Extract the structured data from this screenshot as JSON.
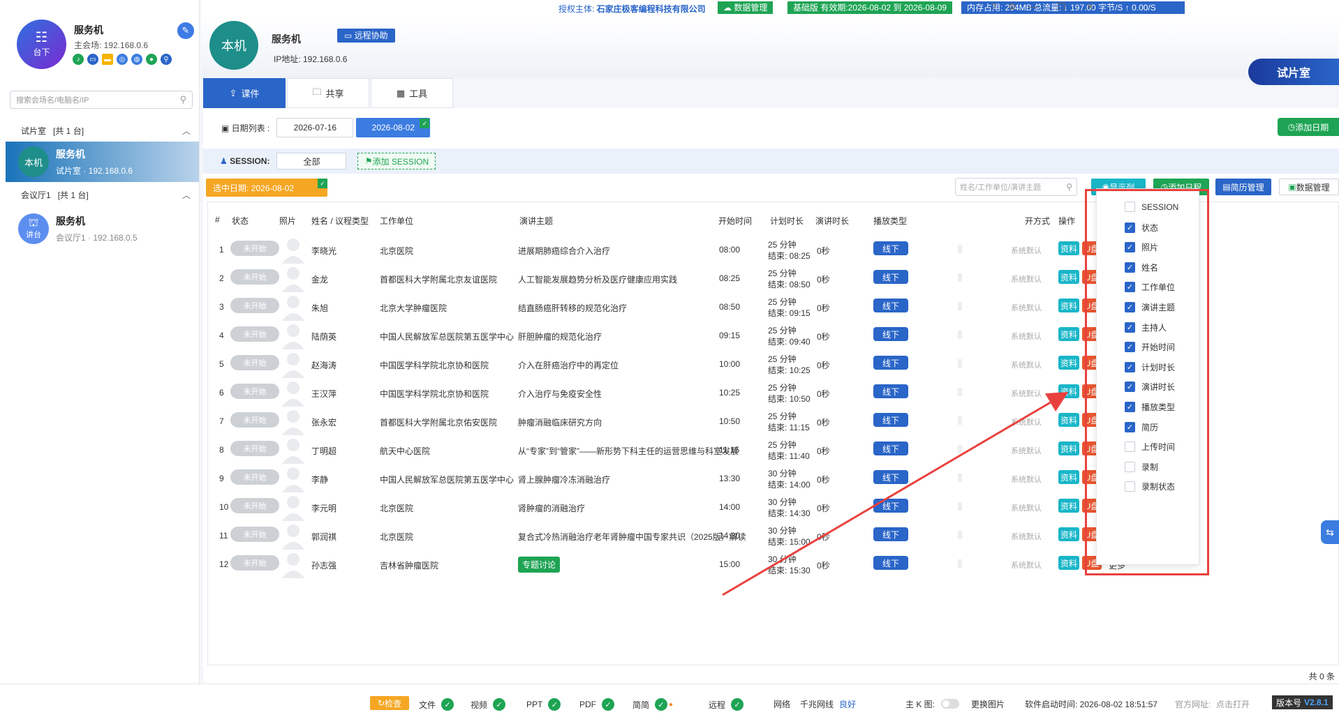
{
  "left": {
    "host": {
      "avatar_line1": "台下",
      "name": "服务机",
      "ip": "主会场: 192.168.0.6"
    },
    "search_placeholder": "搜索会场名/电脑名/IP",
    "groups": [
      {
        "name": "试片室",
        "count": "[共 1 台]"
      },
      {
        "name": "会议厅1",
        "count": "[共 1 台]"
      }
    ],
    "devices": [
      {
        "avatar": "本机",
        "name": "服务机",
        "sub": "试片室 · 192.168.0.6"
      },
      {
        "avatar": "讲台",
        "name": "服务机",
        "sub": "会议厅1 · 192.168.0.5"
      }
    ]
  },
  "topbar": {
    "auth_prefix": "授权主体: ",
    "auth_company": "石家庄极客编程科技有限公司",
    "data_mgmt": "数据管理",
    "license": "基础版 有效期:2026-08-02 到 2026-08-09",
    "memory": "内存占用:  204MB   总流量:  ↓ 197.00 字节/S    ↑ 0.00/S"
  },
  "header": {
    "avatar": "本机",
    "name": "服务机",
    "remote_btn": "远程协助",
    "ip": "IP地址: 192.168.0.6",
    "room": "试片室"
  },
  "tabs": [
    {
      "label": "课件"
    },
    {
      "label": "共享"
    },
    {
      "label": "工具"
    }
  ],
  "dates": {
    "label": "日期列表 :",
    "items": [
      "2026-07-16",
      "2026-08-02"
    ],
    "add_btn": "添加日期"
  },
  "session": {
    "label": "SESSION:",
    "all": "全部",
    "add": "添加 SESSION"
  },
  "selected_date": "选中日期:   2026-08-02",
  "toolbar": {
    "search_placeholder": "姓名/工作单位/演讲主题",
    "show_cols": "显示列",
    "add_schedule": "添加日程",
    "resume_mgmt": "简历管理",
    "data_mgmt": "数据管理"
  },
  "columns": {
    "idx": "#",
    "status": "状态",
    "photo": "照片",
    "name": "姓名 / 议程类型",
    "org": "工作单位",
    "topic": "演讲主题",
    "start": "开始时间",
    "plan": "计划时长",
    "speak": "演讲时长",
    "ptype": "播放类型",
    "mode": "开方式",
    "ops": "操作"
  },
  "rows": [
    {
      "idx": "1",
      "status": "未开始",
      "name": "李晓光",
      "org": "北京医院",
      "topic": "进展期肺癌综合介入治疗",
      "topic_tag": false,
      "start": "08:00",
      "plan1": "25 分钟",
      "plan2": "结束: 08:25",
      "speak": "0秒",
      "ptype": "线下",
      "mode": "系统默认",
      "res": "资料",
      "udisk": "U盘",
      "more": "更多"
    },
    {
      "idx": "2",
      "status": "未开始",
      "name": "金龙",
      "org": "首都医科大学附属北京友谊医院",
      "topic": "人工智能发展趋势分析及医疗健康应用实践",
      "topic_tag": false,
      "start": "08:25",
      "plan1": "25 分钟",
      "plan2": "结束: 08:50",
      "speak": "0秒",
      "ptype": "线下",
      "mode": "系统默认",
      "res": "资料",
      "udisk": "U盘",
      "more": "更多"
    },
    {
      "idx": "3",
      "status": "未开始",
      "name": "朱旭",
      "org": "北京大学肿瘤医院",
      "topic": "结直肠癌肝转移的规范化治疗",
      "topic_tag": false,
      "start": "08:50",
      "plan1": "25 分钟",
      "plan2": "结束: 09:15",
      "speak": "0秒",
      "ptype": "线下",
      "mode": "系统默认",
      "res": "资料",
      "udisk": "U盘",
      "more": "更多"
    },
    {
      "idx": "4",
      "status": "未开始",
      "name": "陆荫英",
      "org": "中国人民解放军总医院第五医学中心",
      "topic": "肝胆肿瘤的规范化治疗",
      "topic_tag": false,
      "start": "09:15",
      "plan1": "25 分钟",
      "plan2": "结束: 09:40",
      "speak": "0秒",
      "ptype": "线下",
      "mode": "系统默认",
      "res": "资料",
      "udisk": "U盘",
      "more": "更多"
    },
    {
      "idx": "5",
      "status": "未开始",
      "name": "赵海涛",
      "org": "中国医学科学院北京协和医院",
      "topic": "介入在肝癌治疗中的再定位",
      "topic_tag": false,
      "start": "10:00",
      "plan1": "25 分钟",
      "plan2": "结束: 10:25",
      "speak": "0秒",
      "ptype": "线下",
      "mode": "系统默认",
      "res": "资料",
      "udisk": "U盘",
      "more": "更多"
    },
    {
      "idx": "6",
      "status": "未开始",
      "name": "王汉萍",
      "org": "中国医学科学院北京协和医院",
      "topic": "介入治疗与免疫安全性",
      "topic_tag": false,
      "start": "10:25",
      "plan1": "25 分钟",
      "plan2": "结束: 10:50",
      "speak": "0秒",
      "ptype": "线下",
      "mode": "系统默认",
      "res": "资料",
      "udisk": "U盘",
      "more": "更多"
    },
    {
      "idx": "7",
      "status": "未开始",
      "name": "张永宏",
      "org": "首都医科大学附属北京佑安医院",
      "topic": "肿瘤消融临床研究方向",
      "topic_tag": false,
      "start": "10:50",
      "plan1": "25 分钟",
      "plan2": "结束: 11:15",
      "speak": "0秒",
      "ptype": "线下",
      "mode": "系统默认",
      "res": "资料",
      "udisk": "U盘",
      "more": "更多"
    },
    {
      "idx": "8",
      "status": "未开始",
      "name": "丁明超",
      "org": "航天中心医院",
      "topic": "从“专家”到“管家”——新形势下科主任的运营思维与科室发展",
      "topic_tag": false,
      "start": "11:15",
      "plan1": "25 分钟",
      "plan2": "结束: 11:40",
      "speak": "0秒",
      "ptype": "线下",
      "mode": "系统默认",
      "res": "资料",
      "udisk": "U盘",
      "more": "更多"
    },
    {
      "idx": "9",
      "status": "未开始",
      "name": "李静",
      "org": "中国人民解放军总医院第五医学中心",
      "topic": "肾上腺肿瘤冷冻消融治疗",
      "topic_tag": false,
      "start": "13:30",
      "plan1": "30 分钟",
      "plan2": "结束: 14:00",
      "speak": "0秒",
      "ptype": "线下",
      "mode": "系统默认",
      "res": "资料",
      "udisk": "U盘",
      "more": "更多"
    },
    {
      "idx": "10",
      "status": "未开始",
      "name": "李元明",
      "org": "北京医院",
      "topic": "肾肿瘤的消融治疗",
      "topic_tag": false,
      "start": "14:00",
      "plan1": "30 分钟",
      "plan2": "结束: 14:30",
      "speak": "0秒",
      "ptype": "线下",
      "mode": "系统默认",
      "res": "资料",
      "udisk": "U盘",
      "more": "更多"
    },
    {
      "idx": "11",
      "status": "未开始",
      "name": "郭润祺",
      "org": "北京医院",
      "topic": "复合式冷热消融治疗老年肾肿瘤中国专家共识（2025版）解读",
      "topic_tag": false,
      "start": "14:30",
      "plan1": "30 分钟",
      "plan2": "结束: 15:00",
      "speak": "0秒",
      "ptype": "线下",
      "mode": "系统默认",
      "res": "资料",
      "udisk": "U盘",
      "more": "更多"
    },
    {
      "idx": "12",
      "status": "未开始",
      "name": "孙志强",
      "org": "吉林省肿瘤医院",
      "topic": "专题讨论",
      "topic_tag": true,
      "start": "15:00",
      "plan1": "30 分钟",
      "plan2": "结束: 15:30",
      "speak": "0秒",
      "ptype": "线下",
      "mode": "系统默认",
      "res": "资料",
      "udisk": "U盘",
      "more": "更多"
    }
  ],
  "total": "共 0 条",
  "column_menu": [
    {
      "label": "SESSION",
      "checked": false
    },
    {
      "label": "状态",
      "checked": true
    },
    {
      "label": "照片",
      "checked": true
    },
    {
      "label": "姓名",
      "checked": true
    },
    {
      "label": "工作单位",
      "checked": true
    },
    {
      "label": "演讲主题",
      "checked": true
    },
    {
      "label": "主持人",
      "checked": true
    },
    {
      "label": "开始时间",
      "checked": true
    },
    {
      "label": "计划时长",
      "checked": true
    },
    {
      "label": "演讲时长",
      "checked": true
    },
    {
      "label": "播放类型",
      "checked": true
    },
    {
      "label": "简历",
      "checked": true
    },
    {
      "label": "上传时间",
      "checked": false
    },
    {
      "label": "录制",
      "checked": false
    },
    {
      "label": "录制状态",
      "checked": false
    }
  ],
  "bottombar": {
    "check": "检查",
    "file": "文件",
    "video": "视频",
    "ppt": "PPT",
    "pdf": "PDF",
    "resume": "简简",
    "remote": "远程",
    "network": "网络",
    "net_type": "千兆网线",
    "net_status": "良好",
    "kmap": "主 K 图:",
    "change_img": "更换图片",
    "start_time": "软件启动时间:  2026-08-02 18:51:57",
    "site": "官方网址:",
    "open": "点击打开",
    "version_label": "版本号",
    "version": "V2.8.1"
  }
}
